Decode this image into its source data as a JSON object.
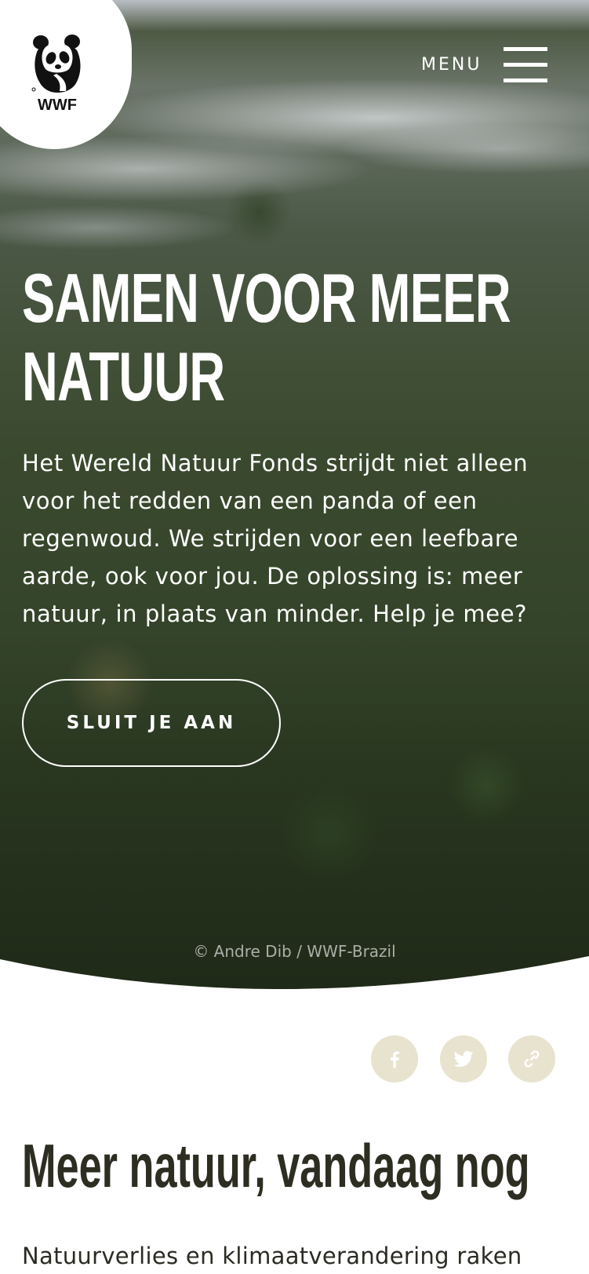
{
  "header": {
    "logo_text": "WWF",
    "menu_label": "MENU",
    "icons": [
      "wwf-panda-logo",
      "hamburger-menu-icon"
    ]
  },
  "hero": {
    "title_lines": [
      "SAMEN VOOR MEER",
      "NATUUR"
    ],
    "text_lines": [
      "Het Wereld Natuur Fonds strijdt niet alleen",
      "voor het redden van een panda of een",
      "regenwoud. We strijden voor een leefbare",
      "aarde, ook voor jou. De oplossing is: meer",
      "natuur, in plaats van minder. Help je mee?"
    ],
    "cta_label": "SLUIT JE AAN",
    "photo_credit": "© Andre Dib / WWF-Brazil"
  },
  "share": {
    "icons": [
      "facebook-icon",
      "twitter-icon",
      "link-icon"
    ],
    "color": "#e7e3cf"
  },
  "section": {
    "title": "Meer natuur, vandaag nog",
    "text": "Natuurverlies en klimaatverandering raken"
  },
  "colors": {
    "heading_dark": "#2d2d22",
    "share_bg": "#e7e3cf"
  }
}
